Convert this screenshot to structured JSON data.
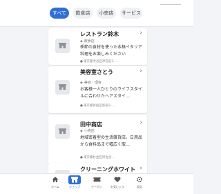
{
  "tabs": [
    {
      "label": "すべて",
      "active": true
    },
    {
      "label": "飲食店",
      "active": false
    },
    {
      "label": "小売店",
      "active": false
    },
    {
      "label": "サービス",
      "active": false
    }
  ],
  "shops": [
    {
      "name": "レストラン鈴木",
      "category": "飲食店",
      "description": "季節の食材を使った本格イタリア料理をお楽しみください",
      "address": "東京都渋谷区神宮前2-…"
    },
    {
      "name": "美容室さとう",
      "category": "美容・理容",
      "description": "お客様一人ひとりのライフスタイルに合わせたヘアスタイ…",
      "address": "東京都新宿区新宿3-…"
    },
    {
      "name": "田中商店",
      "category": "小売店",
      "description": "地域密着型の生活雑貨店。日用品から食料品まで幅広く取…",
      "address": "東京都杉並区阿佐谷…"
    },
    {
      "name": "クリーニングホワイト"
    }
  ],
  "bottom_nav": [
    {
      "label": "ホーム",
      "icon": "home-icon",
      "active": false
    },
    {
      "label": "ショップ",
      "icon": "shop-icon",
      "active": true
    },
    {
      "label": "クーポン",
      "icon": "coupon-icon",
      "active": false
    },
    {
      "label": "お気に入り",
      "icon": "heart-icon",
      "active": false
    },
    {
      "label": "設定",
      "icon": "gear-icon",
      "active": false
    }
  ],
  "colors": {
    "accent": "#2f6fd6",
    "background": "#f3f4f7"
  }
}
